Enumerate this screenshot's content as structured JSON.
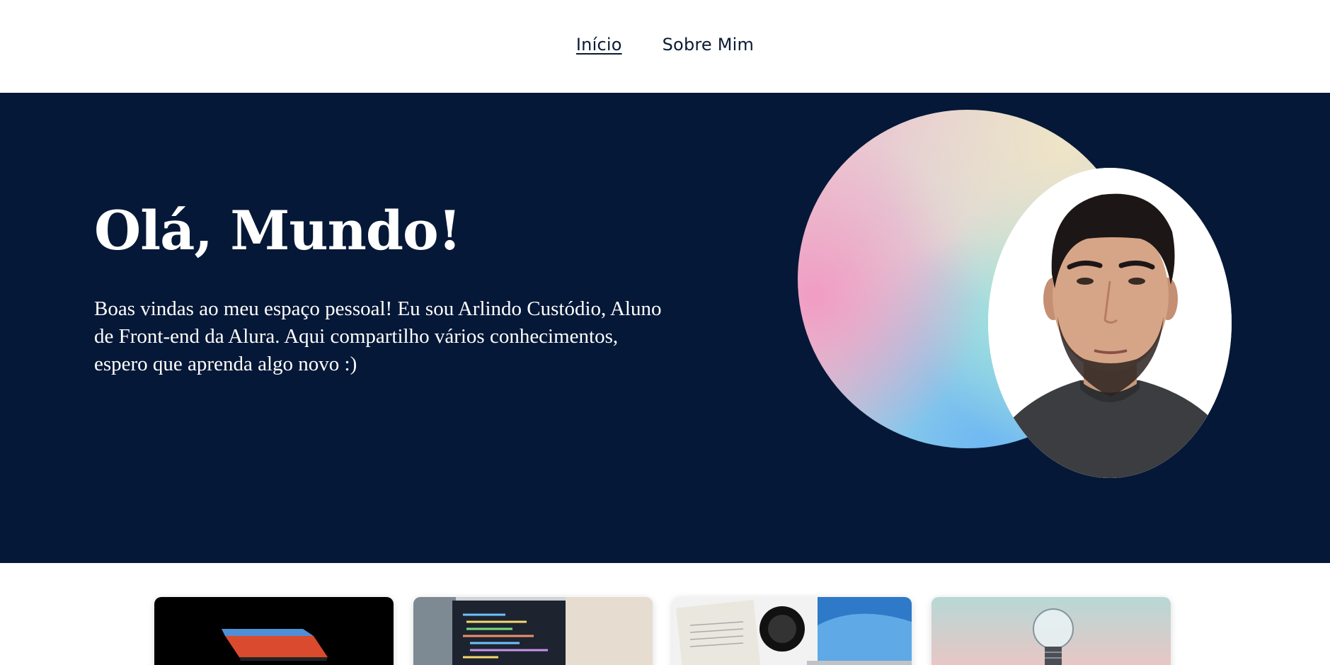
{
  "nav": {
    "items": [
      {
        "label": "Início",
        "active": true
      },
      {
        "label": "Sobre Mim",
        "active": false
      }
    ]
  },
  "hero": {
    "title": "Olá, Mundo!",
    "text": "Boas vindas ao meu espaço pessoal! Eu sou Arlindo Custódio, Aluno de Front-end da Alura. Aqui compartilho vários conhecimentos, espero que aprenda algo novo :)",
    "background": "#061837",
    "portrait_icon": "profile-photo",
    "decoration_icon": "gradient-circle"
  },
  "cards": [
    {
      "icon": "laptop-image"
    },
    {
      "icon": "code-screen-image"
    },
    {
      "icon": "desk-camera-image"
    },
    {
      "icon": "lightbulb-image"
    }
  ]
}
